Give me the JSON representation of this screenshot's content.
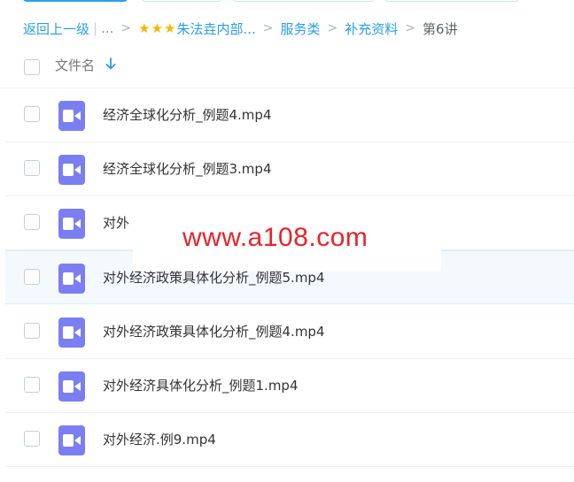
{
  "breadcrumb": {
    "back_label": "返回上一级",
    "pipe": "|",
    "ellipsis": "...",
    "folder_starred": "朱法垚内部...",
    "folder_2": "服务类",
    "folder_3": "补充资料",
    "current": "第6讲"
  },
  "header": {
    "name_column": "文件名"
  },
  "files": [
    {
      "name": "经济全球化分析_例题4.mp4"
    },
    {
      "name": "经济全球化分析_例题3.mp4"
    },
    {
      "name": "对外"
    },
    {
      "name": "对外经济政策具体化分析_例题5.mp4"
    },
    {
      "name": "对外经济政策具体化分析_例题4.mp4"
    },
    {
      "name": "对外经济具体化分析_例题1.mp4"
    },
    {
      "name": "对外经济.例9.mp4"
    }
  ],
  "watermark": "www.a108.com",
  "colors": {
    "accent": "#2a9de8",
    "video_icon": "#7b7ef3",
    "watermark": "#e8232a",
    "star": "#f5b700"
  }
}
